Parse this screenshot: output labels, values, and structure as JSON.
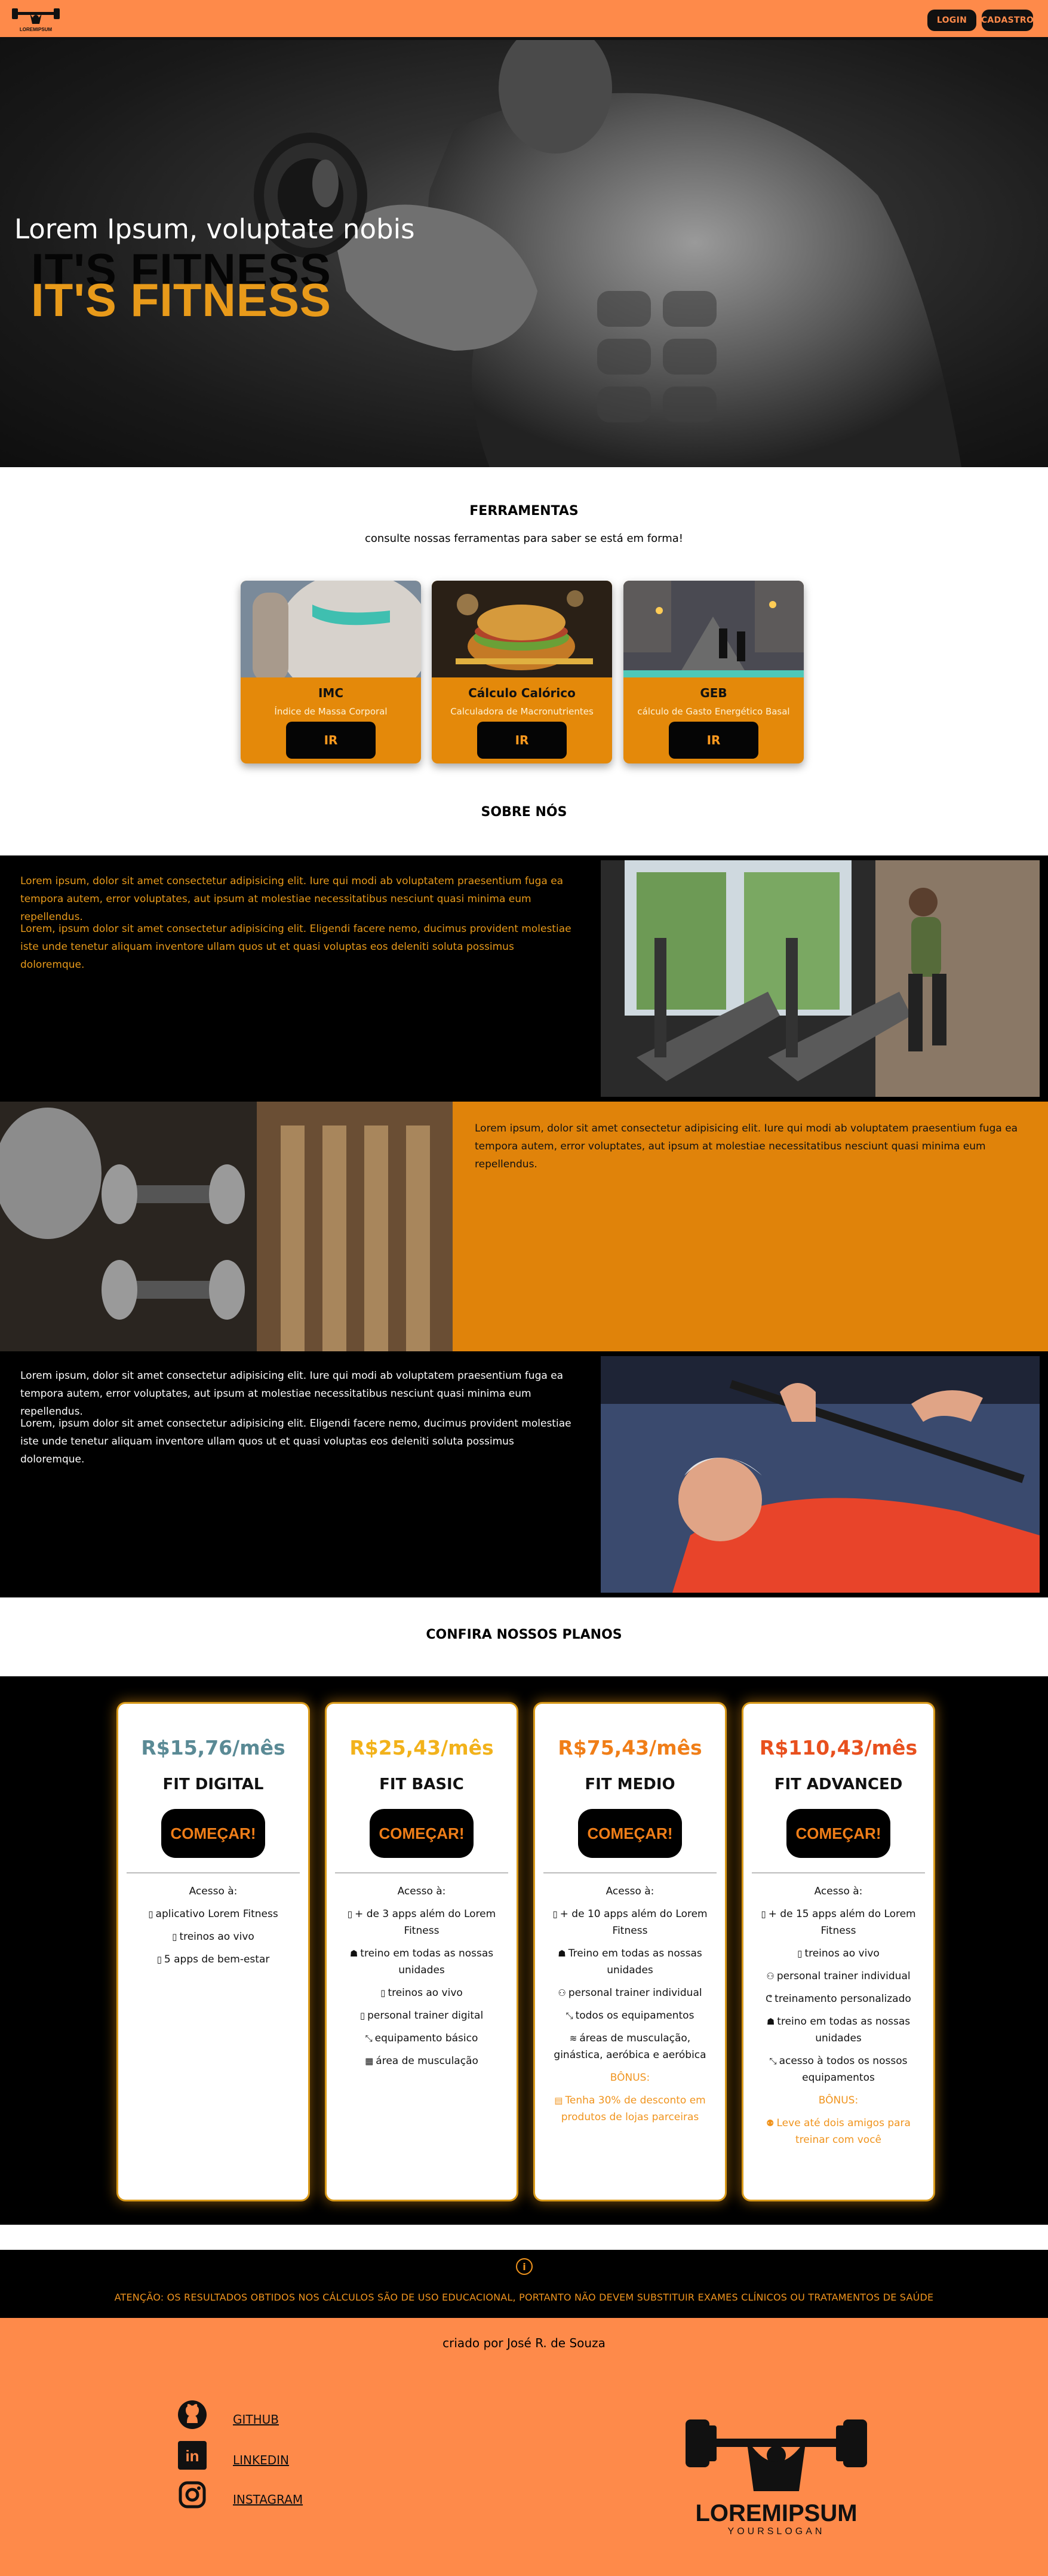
{
  "nav": {
    "login_label": "LOGIN",
    "signup_label": "CADASTRO",
    "logo_text": "LOREMIPSUM"
  },
  "hero": {
    "subtitle": "Lorem Ipsum, voluptate nobis",
    "title": "IT'S FITNESS"
  },
  "tools": {
    "heading": "FERRAMENTAS",
    "subheading": "consulte nossas ferramentas para saber se está em forma!",
    "items": [
      {
        "name": "IMC",
        "desc": "Índice de Massa Corporal",
        "button": "IR"
      },
      {
        "name": "Cálculo Calórico",
        "desc": "Calculadora de Macronutrientes",
        "button": "IR"
      },
      {
        "name": "GEB",
        "desc": "cálculo de Gasto Energético Basal",
        "button": "IR"
      }
    ]
  },
  "about": {
    "heading": "SOBRE NÓS",
    "p1": "Lorem ipsum, dolor sit amet consectetur adipisicing elit. Iure qui modi ab voluptatem praesentium fuga ea tempora autem, error voluptates, aut ipsum at molestiae necessitatibus nesciunt quasi minima eum repellendus.",
    "p2": "Lorem, ipsum dolor sit amet consectetur adipisicing elit. Eligendi facere nemo, ducimus provident molestiae iste unde tenetur aliquam inventore ullam quos ut et quasi voluptas eos deleniti soluta possimus doloremque.",
    "p3": "Lorem ipsum, dolor sit amet consectetur adipisicing elit. Iure qui modi ab voluptatem praesentium fuga ea tempora autem, error voluptates, aut ipsum at molestiae necessitatibus nesciunt quasi minima eum repellendus.",
    "p4": "Lorem ipsum, dolor sit amet consectetur adipisicing elit. Iure qui modi ab voluptatem praesentium fuga ea tempora autem, error voluptates, aut ipsum at molestiae necessitatibus nesciunt quasi minima eum repellendus.",
    "p5": "Lorem, ipsum dolor sit amet consectetur adipisicing elit. Eligendi facere nemo, ducimus provident molestiae iste unde tenetur aliquam inventore ullam quos ut et quasi voluptas eos deleniti soluta possimus doloremque."
  },
  "plans": {
    "heading": "CONFIRA NOSSOS PLANOS",
    "access_label": "Acesso à:",
    "cta": "COMEÇAR!",
    "items": [
      {
        "price": "R$15,76/mês",
        "name": "FIT DIGITAL",
        "price_color": "#5a8a95",
        "features": [
          {
            "icon": "phone-icon",
            "text": "aplicativo Lorem Fitness"
          },
          {
            "icon": "tablet-icon",
            "text": "treinos ao vivo"
          },
          {
            "icon": "phone-icon",
            "text": "5 apps de bem-estar"
          }
        ]
      },
      {
        "price": "R$25,43/mês",
        "name": "FIT BASIC",
        "price_color": "#f2b21b",
        "features": [
          {
            "icon": "phone-icon",
            "text": "+ de 3 apps além do Lorem Fitness"
          },
          {
            "icon": "building-icon",
            "text": "treino em todas as nossas unidades"
          },
          {
            "icon": "tablet-icon",
            "text": "treinos ao vivo"
          },
          {
            "icon": "phone-icon",
            "text": "personal trainer digital"
          },
          {
            "icon": "dumbbell-icon",
            "text": "equipamento básico"
          },
          {
            "icon": "grid-icon",
            "text": "área de musculação"
          }
        ]
      },
      {
        "price": "R$75,43/mês",
        "name": "FIT MEDIO",
        "price_color": "#f07e18",
        "features": [
          {
            "icon": "phone-icon",
            "text": "+ de 10 apps além do Lorem Fitness"
          },
          {
            "icon": "building-icon",
            "text": "Treino em todas as nossas unidades"
          },
          {
            "icon": "trainer-icon",
            "text": "personal trainer individual"
          },
          {
            "icon": "dumbbell-icon",
            "text": "todos os equipamentos"
          },
          {
            "icon": "swim-icon",
            "text": "áreas de musculação, ginástica, aeróbica e aeróbica"
          }
        ],
        "bonus_label": "BÔNUS:",
        "bonus": {
          "icon": "calendar-icon",
          "text": "Tenha 30% de desconto em produtos de lojas parceiras"
        }
      },
      {
        "price": "R$110,43/mês",
        "name": "FIT ADVANCED",
        "price_color": "#e8501e",
        "features": [
          {
            "icon": "phone-icon",
            "text": "+ de 15 apps além do Lorem Fitness"
          },
          {
            "icon": "tablet-icon",
            "text": "treinos ao vivo"
          },
          {
            "icon": "trainer-icon",
            "text": "personal trainer individual"
          },
          {
            "icon": "muscle-icon",
            "text": "treinamento personalizado"
          },
          {
            "icon": "building-icon",
            "text": "treino em todas as nossas unidades"
          },
          {
            "icon": "dumbbell-icon",
            "text": "acesso à todos os nossos equipamentos"
          }
        ],
        "bonus_label": "BÔNUS:",
        "bonus": {
          "icon": "friends-icon",
          "text": "Leve até dois amigos para treinar com você"
        }
      }
    ]
  },
  "warning": {
    "text": "ATENÇÃO: OS RESULTADOS OBTIDOS NOS CÁLCULOS SÃO DE USO EDUCACIONAL, PORTANTO NÃO DEVEM SUBSTITUIR EXAMES CLÍNICOS OU TRATAMENTOS DE SAÚDE"
  },
  "footer": {
    "credit": "criado por José R. de Souza",
    "links": [
      {
        "label": "GITHUB",
        "icon": "github-icon"
      },
      {
        "label": "LINKEDIN",
        "icon": "linkedin-icon"
      },
      {
        "label": "INSTAGRAM",
        "icon": "instagram-icon"
      }
    ],
    "logo_name": "LOREMIPSUM",
    "logo_slogan": "YOURSLOGAN"
  },
  "colors": {
    "nav": "#fe8a4a",
    "accent": "#e4890a",
    "dark": "#000000"
  }
}
